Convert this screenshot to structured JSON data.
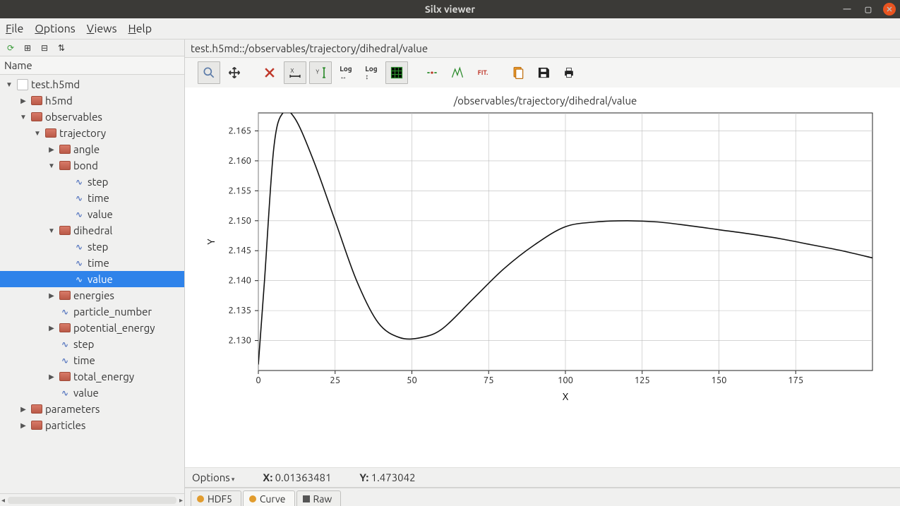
{
  "window": {
    "title": "Silx viewer"
  },
  "menu": {
    "file": "File",
    "options": "Options",
    "views": "Views",
    "help": "Help"
  },
  "tree": {
    "header": "Name",
    "root": {
      "label": "test.h5md"
    },
    "observables": "observables",
    "trajectory": "trajectory",
    "angle": "angle",
    "bond": "bond",
    "bond_step": "step",
    "bond_time": "time",
    "bond_value": "value",
    "dihedral": "dihedral",
    "dih_step": "step",
    "dih_time": "time",
    "dih_value": "value",
    "energies": "energies",
    "particle_number": "particle_number",
    "potential_energy": "potential_energy",
    "step": "step",
    "time": "time",
    "total_energy": "total_energy",
    "value": "value",
    "h5md": "h5md",
    "parameters": "parameters",
    "particles": "particles"
  },
  "path": "test.h5md::/observables/trajectory/dihedral/value",
  "toolbar_icons": {
    "zoom": "zoom-icon",
    "pan": "pan-icon",
    "reset": "reset-icon",
    "xscale": "x-autoscale-icon",
    "yscale": "y-autoscale-icon",
    "xlog": "x-log-icon",
    "ylog": "y-log-icon",
    "grid": "grid-icon",
    "style": "style-icon",
    "peaks": "peaks-icon",
    "fit": "fit-icon",
    "copy": "copy-icon",
    "save": "save-icon",
    "print": "print-icon"
  },
  "status": {
    "options": "Options",
    "x_label": "X:",
    "x_val": "0.01363481",
    "y_label": "Y:",
    "y_val": "1.473042"
  },
  "tabs": {
    "hdf5": "HDF5",
    "curve": "Curve",
    "raw": "Raw"
  },
  "chart_data": {
    "type": "line",
    "title": "/observables/trajectory/dihedral/value",
    "xlabel": "X",
    "ylabel": "Y",
    "xlim": [
      0,
      200
    ],
    "ylim": [
      2.125,
      2.168
    ],
    "xticks": [
      0,
      25,
      50,
      75,
      100,
      125,
      150,
      175
    ],
    "yticks": [
      2.13,
      2.135,
      2.14,
      2.145,
      2.15,
      2.155,
      2.16,
      2.165
    ],
    "series": [
      {
        "name": "value",
        "x": [
          0,
          2,
          5,
          8,
          12,
          18,
          25,
          32,
          39,
          46,
          53,
          60,
          70,
          80,
          90,
          100,
          110,
          120,
          130,
          140,
          150,
          160,
          170,
          180,
          190,
          200
        ],
        "values": [
          2.126,
          2.14,
          2.162,
          2.168,
          2.167,
          2.16,
          2.15,
          2.14,
          2.133,
          2.1305,
          2.1305,
          2.132,
          2.137,
          2.142,
          2.146,
          2.149,
          2.1498,
          2.15,
          2.1498,
          2.1492,
          2.1485,
          2.1478,
          2.147,
          2.146,
          2.145,
          2.1438
        ]
      }
    ]
  }
}
